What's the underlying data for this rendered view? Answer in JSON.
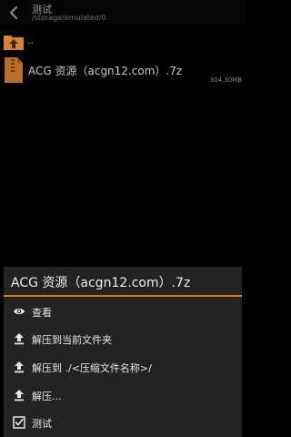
{
  "header": {
    "title": "测试",
    "path": "/storage/emulated/0"
  },
  "list": {
    "parent_label": "..",
    "file": {
      "name": "ACG 资源（acgn12.com）.7z",
      "size": "304.30MB"
    }
  },
  "sheet": {
    "title": "ACG 资源（acgn12.com）.7z",
    "items": [
      {
        "label": "查看",
        "icon": "eye-icon"
      },
      {
        "label": "解压到当前文件夹",
        "icon": "upload-icon"
      },
      {
        "label": "解压到 ./<压缩文件名称>/",
        "icon": "upload-icon"
      },
      {
        "label": "解压...",
        "icon": "upload-icon"
      },
      {
        "label": "测试",
        "icon": "checkbox-icon"
      }
    ]
  },
  "colors": {
    "accent": "#e07b1b",
    "sheet_bg": "#232323",
    "background": "#000000"
  }
}
